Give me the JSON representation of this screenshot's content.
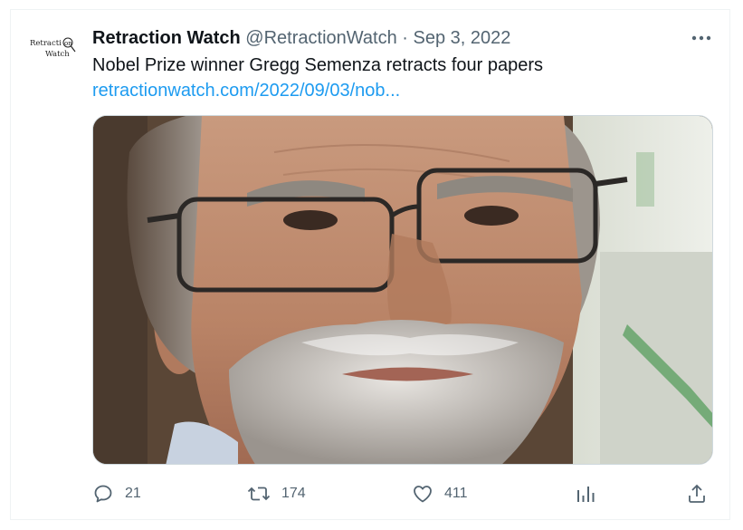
{
  "tweet": {
    "author_name": "Retraction Watch",
    "author_handle": "@RetractionWatch",
    "separator": "·",
    "date": "Sep 3, 2022",
    "text": "Nobel Prize winner Gregg Semenza retracts four papers",
    "link": "retractionwatch.com/2022/09/03/nob...",
    "avatar_logo_text": "Retraction Watch",
    "more_icon": "more-horizontal-icon",
    "media_description": "photo"
  },
  "actions": {
    "reply": {
      "icon": "reply-icon",
      "count": "21"
    },
    "retweet": {
      "icon": "retweet-icon",
      "count": "174"
    },
    "like": {
      "icon": "heart-icon",
      "count": "411"
    },
    "views": {
      "icon": "analytics-icon"
    },
    "share": {
      "icon": "share-icon"
    }
  },
  "colors": {
    "text": "#0f1419",
    "secondary": "#536471",
    "link": "#1d9bf0",
    "border": "#eff3f4"
  }
}
